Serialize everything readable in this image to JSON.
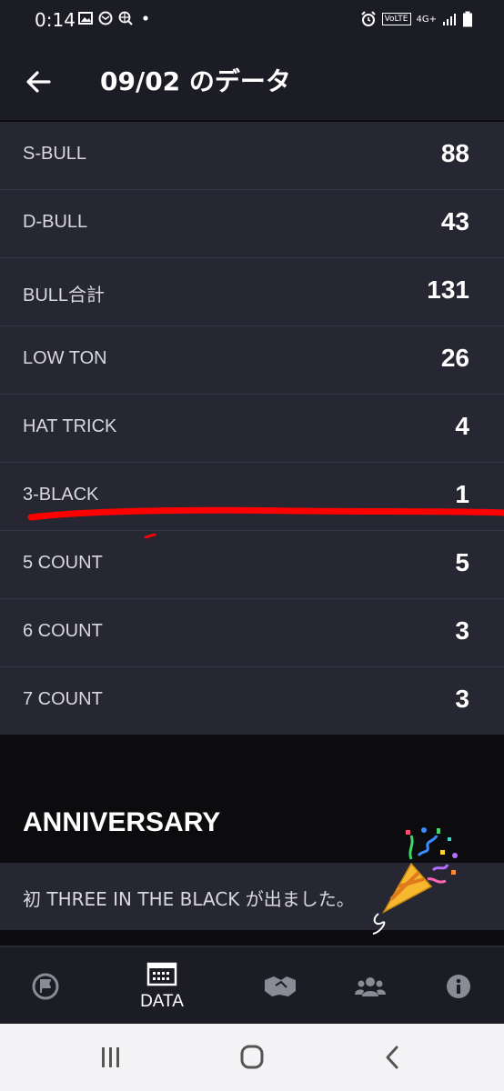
{
  "status": {
    "time": "0:14",
    "network": "4G+",
    "volte": "VoLTE"
  },
  "header": {
    "title": "09/02 のデータ"
  },
  "stats": [
    {
      "label": "S-BULL",
      "value": "88"
    },
    {
      "label": "D-BULL",
      "value": "43"
    },
    {
      "label": "BULL合計",
      "value": "131"
    },
    {
      "label": "LOW TON",
      "value": "26"
    },
    {
      "label": "HAT TRICK",
      "value": "4"
    },
    {
      "label": "3-BLACK",
      "value": "1"
    },
    {
      "label": "5 COUNT",
      "value": "5"
    },
    {
      "label": "6 COUNT",
      "value": "3"
    },
    {
      "label": "7 COUNT",
      "value": "3"
    }
  ],
  "anniversary": {
    "title": "ANNIVERSARY",
    "message": "初 THREE IN THE BLACK が出ました。"
  },
  "nav": {
    "data_label": "DATA"
  },
  "icons": [
    "back-arrow-icon",
    "party-popper-icon",
    "flag-icon",
    "calendar-icon",
    "handshake-icon",
    "group-icon",
    "info-icon"
  ],
  "colors": {
    "background": "#0c0c0f",
    "panel": "#262732",
    "bar": "#1c1c24",
    "annotation_line": "#ff0000"
  }
}
